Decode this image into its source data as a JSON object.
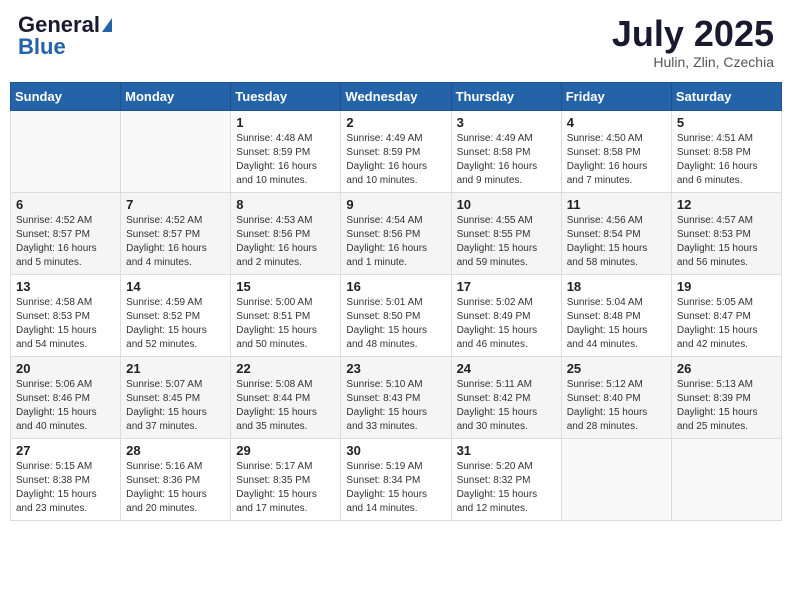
{
  "header": {
    "logo_general": "General",
    "logo_blue": "Blue",
    "month": "July 2025",
    "location": "Hulin, Zlin, Czechia"
  },
  "days_of_week": [
    "Sunday",
    "Monday",
    "Tuesday",
    "Wednesday",
    "Thursday",
    "Friday",
    "Saturday"
  ],
  "weeks": [
    [
      {
        "day": "",
        "info": ""
      },
      {
        "day": "",
        "info": ""
      },
      {
        "day": "1",
        "info": "Sunrise: 4:48 AM\nSunset: 8:59 PM\nDaylight: 16 hours and 10 minutes."
      },
      {
        "day": "2",
        "info": "Sunrise: 4:49 AM\nSunset: 8:59 PM\nDaylight: 16 hours and 10 minutes."
      },
      {
        "day": "3",
        "info": "Sunrise: 4:49 AM\nSunset: 8:58 PM\nDaylight: 16 hours and 9 minutes."
      },
      {
        "day": "4",
        "info": "Sunrise: 4:50 AM\nSunset: 8:58 PM\nDaylight: 16 hours and 7 minutes."
      },
      {
        "day": "5",
        "info": "Sunrise: 4:51 AM\nSunset: 8:58 PM\nDaylight: 16 hours and 6 minutes."
      }
    ],
    [
      {
        "day": "6",
        "info": "Sunrise: 4:52 AM\nSunset: 8:57 PM\nDaylight: 16 hours and 5 minutes."
      },
      {
        "day": "7",
        "info": "Sunrise: 4:52 AM\nSunset: 8:57 PM\nDaylight: 16 hours and 4 minutes."
      },
      {
        "day": "8",
        "info": "Sunrise: 4:53 AM\nSunset: 8:56 PM\nDaylight: 16 hours and 2 minutes."
      },
      {
        "day": "9",
        "info": "Sunrise: 4:54 AM\nSunset: 8:56 PM\nDaylight: 16 hours and 1 minute."
      },
      {
        "day": "10",
        "info": "Sunrise: 4:55 AM\nSunset: 8:55 PM\nDaylight: 15 hours and 59 minutes."
      },
      {
        "day": "11",
        "info": "Sunrise: 4:56 AM\nSunset: 8:54 PM\nDaylight: 15 hours and 58 minutes."
      },
      {
        "day": "12",
        "info": "Sunrise: 4:57 AM\nSunset: 8:53 PM\nDaylight: 15 hours and 56 minutes."
      }
    ],
    [
      {
        "day": "13",
        "info": "Sunrise: 4:58 AM\nSunset: 8:53 PM\nDaylight: 15 hours and 54 minutes."
      },
      {
        "day": "14",
        "info": "Sunrise: 4:59 AM\nSunset: 8:52 PM\nDaylight: 15 hours and 52 minutes."
      },
      {
        "day": "15",
        "info": "Sunrise: 5:00 AM\nSunset: 8:51 PM\nDaylight: 15 hours and 50 minutes."
      },
      {
        "day": "16",
        "info": "Sunrise: 5:01 AM\nSunset: 8:50 PM\nDaylight: 15 hours and 48 minutes."
      },
      {
        "day": "17",
        "info": "Sunrise: 5:02 AM\nSunset: 8:49 PM\nDaylight: 15 hours and 46 minutes."
      },
      {
        "day": "18",
        "info": "Sunrise: 5:04 AM\nSunset: 8:48 PM\nDaylight: 15 hours and 44 minutes."
      },
      {
        "day": "19",
        "info": "Sunrise: 5:05 AM\nSunset: 8:47 PM\nDaylight: 15 hours and 42 minutes."
      }
    ],
    [
      {
        "day": "20",
        "info": "Sunrise: 5:06 AM\nSunset: 8:46 PM\nDaylight: 15 hours and 40 minutes."
      },
      {
        "day": "21",
        "info": "Sunrise: 5:07 AM\nSunset: 8:45 PM\nDaylight: 15 hours and 37 minutes."
      },
      {
        "day": "22",
        "info": "Sunrise: 5:08 AM\nSunset: 8:44 PM\nDaylight: 15 hours and 35 minutes."
      },
      {
        "day": "23",
        "info": "Sunrise: 5:10 AM\nSunset: 8:43 PM\nDaylight: 15 hours and 33 minutes."
      },
      {
        "day": "24",
        "info": "Sunrise: 5:11 AM\nSunset: 8:42 PM\nDaylight: 15 hours and 30 minutes."
      },
      {
        "day": "25",
        "info": "Sunrise: 5:12 AM\nSunset: 8:40 PM\nDaylight: 15 hours and 28 minutes."
      },
      {
        "day": "26",
        "info": "Sunrise: 5:13 AM\nSunset: 8:39 PM\nDaylight: 15 hours and 25 minutes."
      }
    ],
    [
      {
        "day": "27",
        "info": "Sunrise: 5:15 AM\nSunset: 8:38 PM\nDaylight: 15 hours and 23 minutes."
      },
      {
        "day": "28",
        "info": "Sunrise: 5:16 AM\nSunset: 8:36 PM\nDaylight: 15 hours and 20 minutes."
      },
      {
        "day": "29",
        "info": "Sunrise: 5:17 AM\nSunset: 8:35 PM\nDaylight: 15 hours and 17 minutes."
      },
      {
        "day": "30",
        "info": "Sunrise: 5:19 AM\nSunset: 8:34 PM\nDaylight: 15 hours and 14 minutes."
      },
      {
        "day": "31",
        "info": "Sunrise: 5:20 AM\nSunset: 8:32 PM\nDaylight: 15 hours and 12 minutes."
      },
      {
        "day": "",
        "info": ""
      },
      {
        "day": "",
        "info": ""
      }
    ]
  ]
}
